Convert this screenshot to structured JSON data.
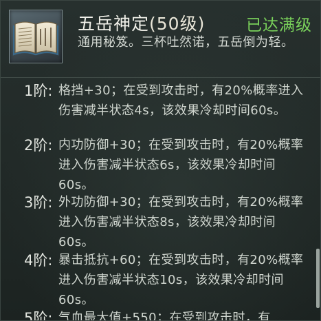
{
  "item": {
    "name": "五岳神定",
    "level": "(50级)",
    "status": "已达满级",
    "description": "通用秘笈。三杯吐然诺，五岳倒为轻。",
    "icon": "book-icon"
  },
  "tiers": [
    {
      "label": "1阶:",
      "text": "格挡+30；在受到攻击时，有20%概率进入伤害减半状态4s，该效果冷却时间60s。"
    },
    {
      "label": "2阶:",
      "text": "内功防御+30；在受到攻击时，有20%概率进入伤害减半状态6s，该效果冷却时间60s。"
    },
    {
      "label": "3阶:",
      "text": "外功防御+30；在受到攻击时，有20%概率进入伤害减半状态8s，该效果冷却时间60s。"
    },
    {
      "label": "4阶:",
      "text": "暴击抵抗+60；在受到攻击时，有20%概率进入伤害减半状态10s，该效果冷却时间60s。"
    },
    {
      "label": "5阶:",
      "text": "气血最大值+550；在受到攻击时，有"
    }
  ],
  "colors": {
    "status": "#7ad25b",
    "title": "#f1f1ea",
    "body": "#d0d6cf"
  }
}
